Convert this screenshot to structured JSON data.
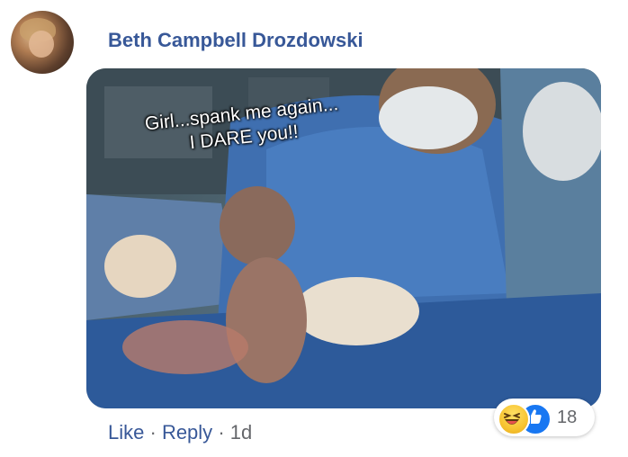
{
  "comment": {
    "author": "Beth Campbell Drozdowski",
    "image": {
      "caption_line1": "Girl...spank me again...",
      "caption_line2": "I DARE you!!"
    },
    "actions": {
      "like_label": "Like",
      "separator": "·",
      "reply_label": "Reply",
      "timestamp": "1d"
    },
    "reactions": {
      "icons": [
        "haha-icon",
        "like-icon"
      ],
      "count": "18"
    }
  },
  "colors": {
    "link": "#385898",
    "meta": "#65676b",
    "like_blue": "#1877f2",
    "haha_yellow": "#f7c431"
  }
}
